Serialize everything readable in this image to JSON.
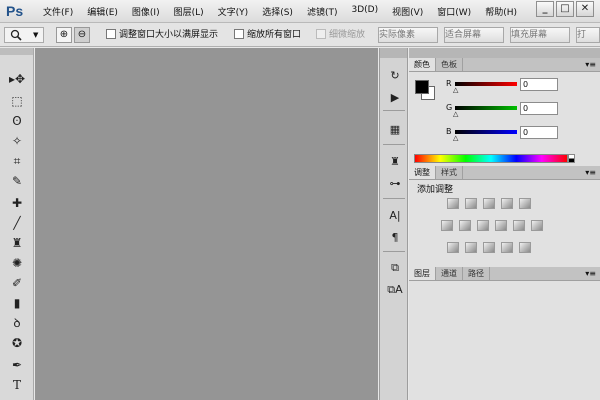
{
  "app": {
    "logo": "Ps",
    "menu": [
      "文件(F)",
      "编辑(E)",
      "图像(I)",
      "图层(L)",
      "文字(Y)",
      "选择(S)",
      "滤镜(T)",
      "3D(D)",
      "视图(V)",
      "窗口(W)",
      "帮助(H)"
    ],
    "window_buttons": [
      "_",
      "□",
      "✕"
    ]
  },
  "options_bar": {
    "tool_icon": "zoom-icon",
    "zoom_in_glyph": "⊕",
    "zoom_out_glyph": "⊖",
    "resize_windows_label": "调整窗口大小以满屏显示",
    "zoom_all_windows_label": "缩放所有窗口",
    "scrubby_zoom_label": "细微缩放",
    "actual_pixels_label": "实际像素",
    "fit_screen_label": "适合屏幕",
    "fill_screen_label": "填充屏幕",
    "print_size_label": "打"
  },
  "toolbar": {
    "tools": [
      "▸✥",
      "⬚",
      "ʘ",
      "✧",
      "⌗",
      "✎",
      "✚",
      "╱",
      "♜",
      "✺",
      "✐",
      "▮",
      "ꝺ",
      "✪",
      "✒",
      "T"
    ]
  },
  "dock": {
    "icons": [
      "↻",
      "▶",
      "▦",
      "♜",
      "⊶",
      "A|",
      "¶",
      "⧉",
      "⧉A"
    ]
  },
  "panels": {
    "color": {
      "tabs": [
        "颜色",
        "色板"
      ],
      "channels": [
        {
          "label": "R",
          "value": "0",
          "color": "#cc0000"
        },
        {
          "label": "G",
          "value": "0",
          "color": "#00a000"
        },
        {
          "label": "B",
          "value": "0",
          "color": "#0000cc"
        }
      ]
    },
    "adjustments": {
      "tabs": [
        "调整",
        "样式"
      ],
      "title": "添加调整"
    },
    "layers": {
      "tabs": [
        "图层",
        "通道",
        "路径"
      ]
    },
    "menu_glyph": "▾≡"
  }
}
